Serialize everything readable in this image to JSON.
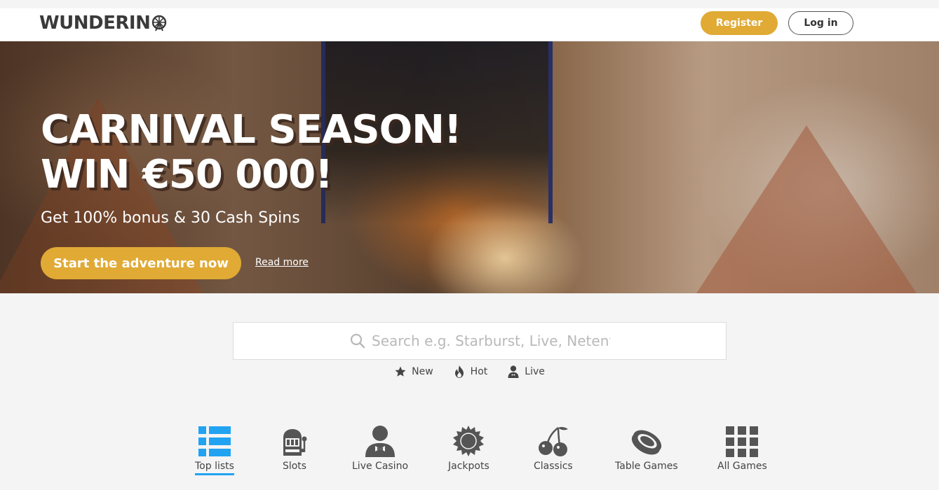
{
  "header": {
    "logo_text": "WUNDERIN",
    "register_label": "Register",
    "login_label": "Log in",
    "accent_color": "#e0aa35"
  },
  "hero": {
    "title_line1": "CARNIVAL SEASON!",
    "title_line2": "WIN €50 000!",
    "subtitle": "Get 100% bonus & 30 Cash Spins",
    "cta_label": "Start the adventure now",
    "read_more_label": "Read more"
  },
  "search": {
    "placeholder": "Search e.g. Starburst, Live, Netent",
    "icon": "search-icon"
  },
  "quick_filters": [
    {
      "label": "New",
      "icon": "star-icon"
    },
    {
      "label": "Hot",
      "icon": "flame-icon"
    },
    {
      "label": "Live",
      "icon": "dealer-icon"
    }
  ],
  "categories": [
    {
      "label": "Top lists",
      "icon": "list-icon",
      "active": true
    },
    {
      "label": "Slots",
      "icon": "slot-machine-icon"
    },
    {
      "label": "Live Casino",
      "icon": "dealer-icon"
    },
    {
      "label": "Jackpots",
      "icon": "jackpot-badge-icon"
    },
    {
      "label": "Classics",
      "icon": "cherry-icon"
    },
    {
      "label": "Table Games",
      "icon": "chip-icon"
    },
    {
      "label": "All Games",
      "icon": "grid-icon"
    }
  ],
  "colors": {
    "active_tab": "#21a3f2",
    "icon_gray": "#555555"
  }
}
